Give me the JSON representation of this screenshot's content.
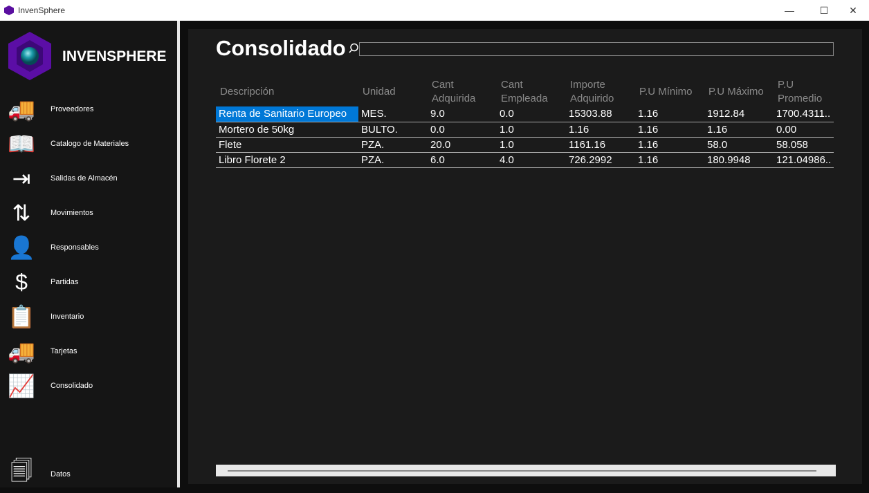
{
  "window": {
    "title": "InvenSphere",
    "minimize": "—",
    "maximize": "☐",
    "close": "✕"
  },
  "brand": "INVENSPHERE",
  "sidebar": {
    "items": [
      {
        "label": "Proveedores",
        "icon": "truck-icon",
        "glyph": "🚚"
      },
      {
        "label": "Catalogo de Materiales",
        "icon": "book-icon",
        "glyph": "📖"
      },
      {
        "label": "Salidas de Almacén",
        "icon": "exit-icon",
        "glyph": "⇥"
      },
      {
        "label": "Movimientos",
        "icon": "arrows-updown-icon",
        "glyph": "⇅"
      },
      {
        "label": "Responsables",
        "icon": "person-icon",
        "glyph": "👤"
      },
      {
        "label": "Partidas",
        "icon": "calculator-dollar-icon",
        "glyph": "$"
      },
      {
        "label": "Inventario",
        "icon": "clipboard-icon",
        "glyph": "📋"
      },
      {
        "label": "Tarjetas",
        "icon": "truck-icon",
        "glyph": "🚚"
      },
      {
        "label": "Consolidado",
        "icon": "chart-icon",
        "glyph": "📈"
      },
      {
        "label": "Datos",
        "icon": "documents-icon",
        "glyph": "🗐"
      }
    ]
  },
  "main": {
    "title": "Consolidado",
    "search_value": "",
    "columns": [
      "Descripción",
      "Unidad",
      "Cant Adquirida",
      "Cant Empleada",
      "Importe Adquirido",
      "P.U Mínimo",
      "P.U Máximo",
      "P.U Promedio"
    ],
    "rows": [
      [
        "Renta de Sanitario Europeo",
        "MES.",
        "9.0",
        "0.0",
        "15303.88",
        "1.16",
        "1912.84",
        "1700.4311.."
      ],
      [
        "Mortero de 50kg",
        "BULTO.",
        "0.0",
        "1.0",
        "1.16",
        "1.16",
        "1.16",
        "0.00"
      ],
      [
        "Flete",
        "PZA.",
        "20.0",
        "1.0",
        "1161.16",
        "1.16",
        "58.0",
        "58.058"
      ],
      [
        "Libro Florete 2",
        "PZA.",
        "6.0",
        "4.0",
        "726.2992",
        "1.16",
        "180.9948",
        "121.04986.."
      ]
    ]
  }
}
